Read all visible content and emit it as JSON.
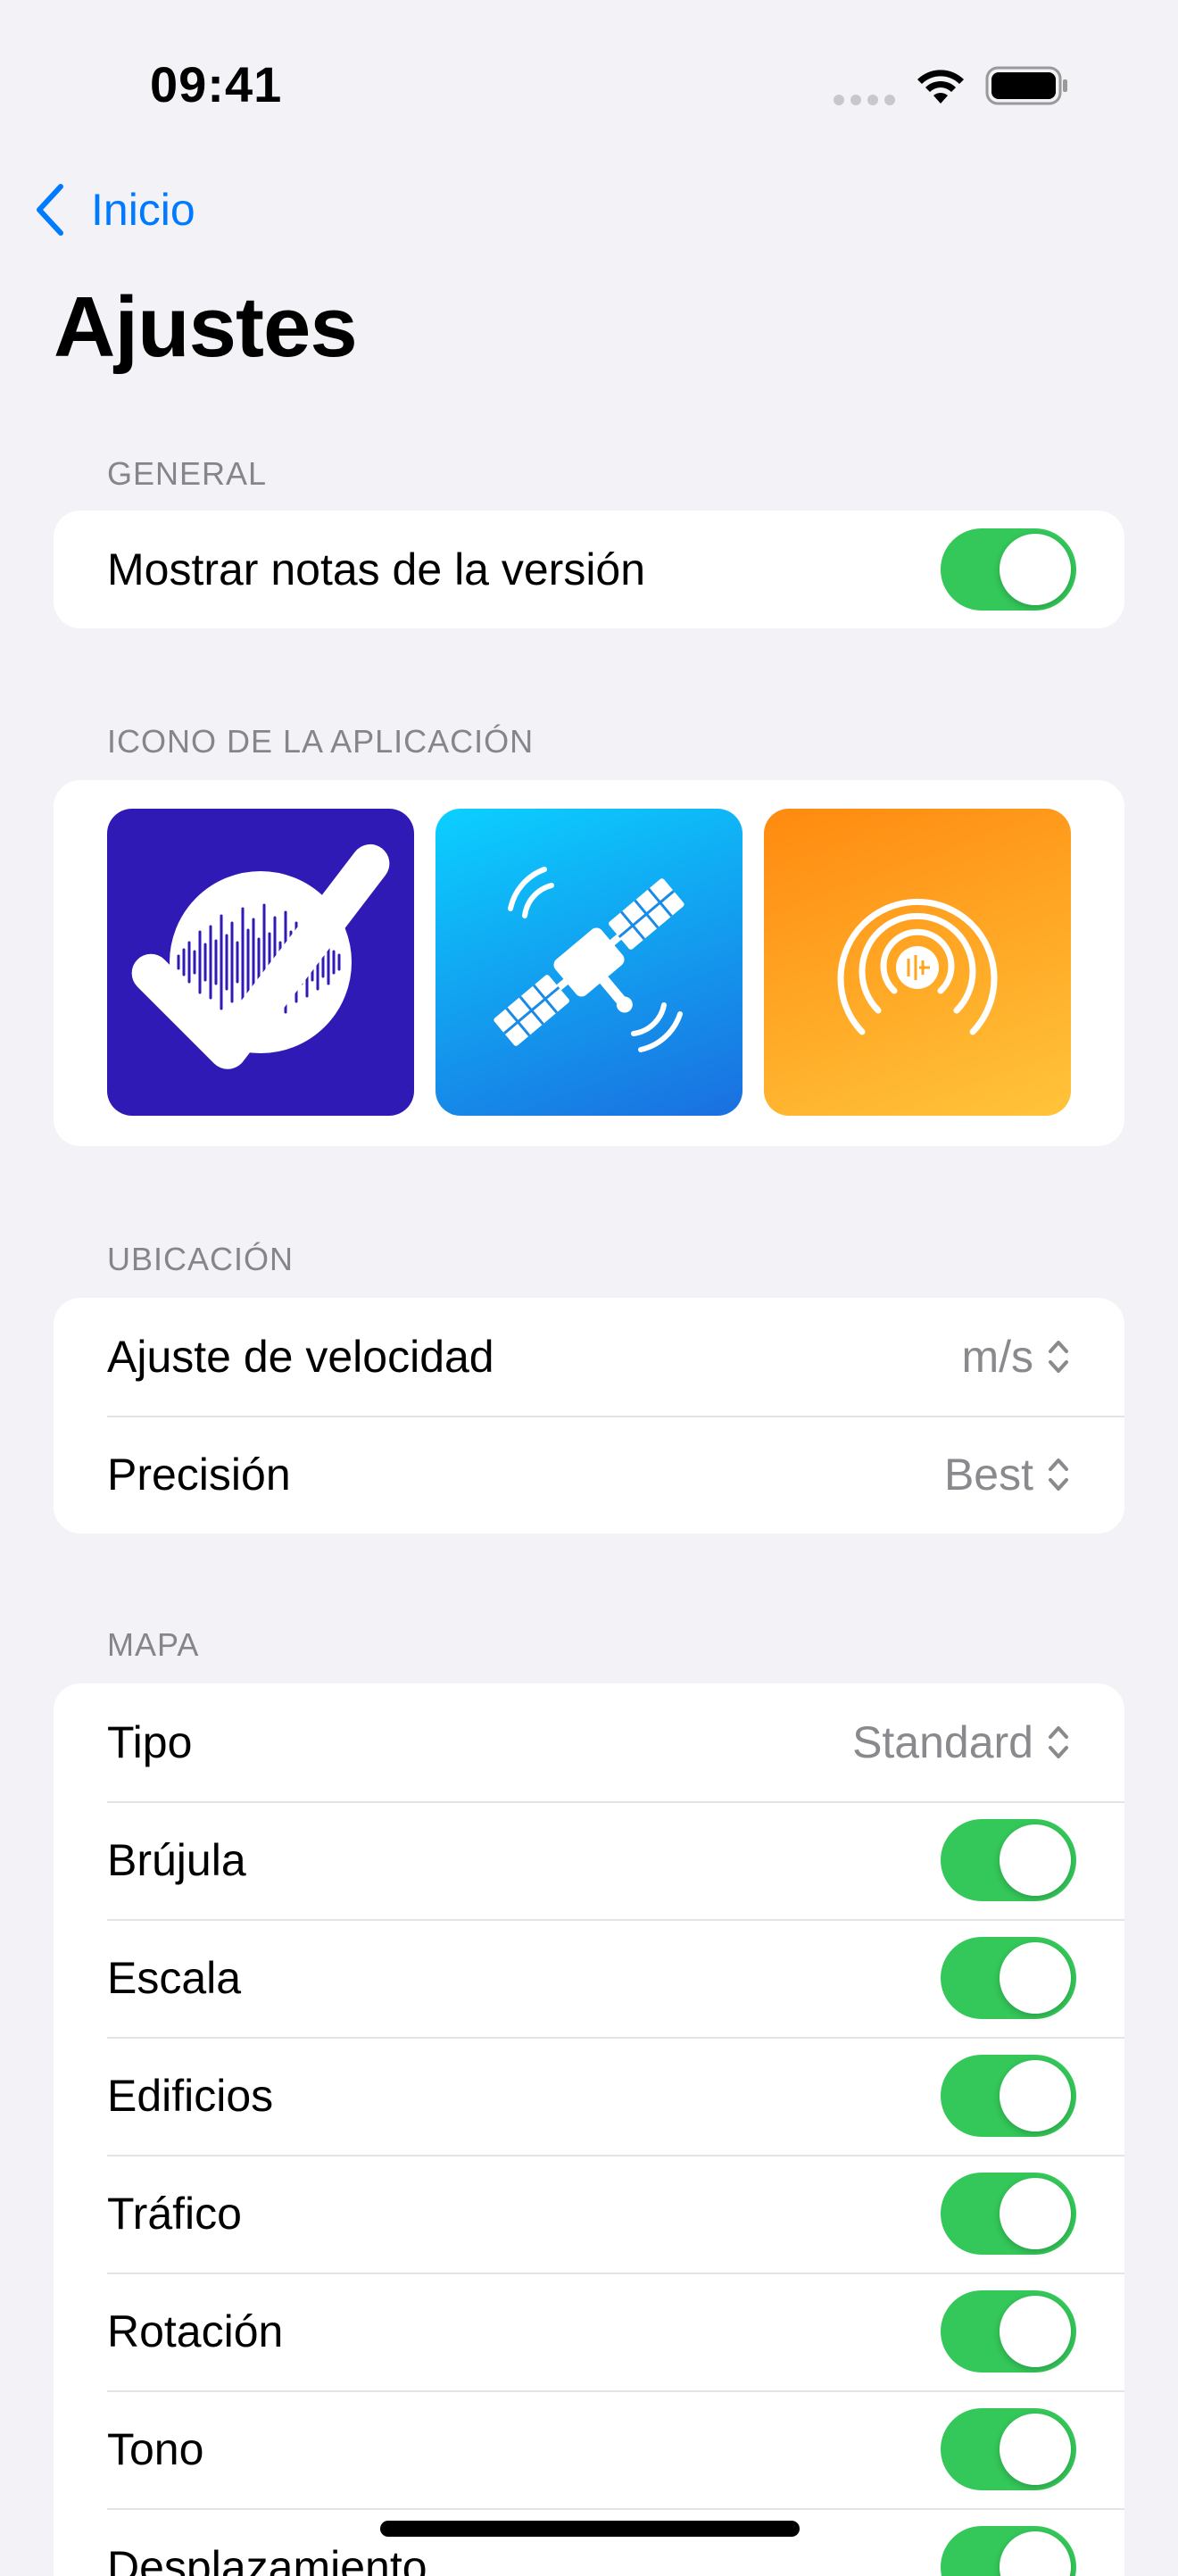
{
  "status_bar": {
    "time": "09:41"
  },
  "nav": {
    "back_label": "Inicio"
  },
  "title": "Ajustes",
  "sections": {
    "general": {
      "header": "GENERAL",
      "rows": [
        {
          "label": "Mostrar notas de la versión",
          "toggle": true
        }
      ]
    },
    "app_icon": {
      "header": "ICONO DE LA APLICACIÓN",
      "icons": [
        {
          "name": "waveform-icon",
          "background": "#2f1ab5",
          "selected": true
        },
        {
          "name": "satellite-icon",
          "background": "#0aa8f5",
          "selected": false
        },
        {
          "name": "broadcast-icon",
          "background": "#ff9a1a",
          "selected": false
        }
      ]
    },
    "location": {
      "header": "UBICACIÓN",
      "rows": [
        {
          "label": "Ajuste de velocidad",
          "value": "m/s"
        },
        {
          "label": "Precisión",
          "value": "Best"
        }
      ]
    },
    "map": {
      "header": "MAPA",
      "rows": [
        {
          "label": "Tipo",
          "value": "Standard"
        },
        {
          "label": "Brújula",
          "toggle": true
        },
        {
          "label": "Escala",
          "toggle": true
        },
        {
          "label": "Edificios",
          "toggle": true
        },
        {
          "label": "Tráfico",
          "toggle": true
        },
        {
          "label": "Rotación",
          "toggle": true
        },
        {
          "label": "Tono",
          "toggle": true
        },
        {
          "label": "Desplazamiento",
          "toggle": true
        }
      ]
    }
  },
  "colors": {
    "accent": "#007aff",
    "toggle_on": "#34c759",
    "background": "#f2f2f7"
  }
}
